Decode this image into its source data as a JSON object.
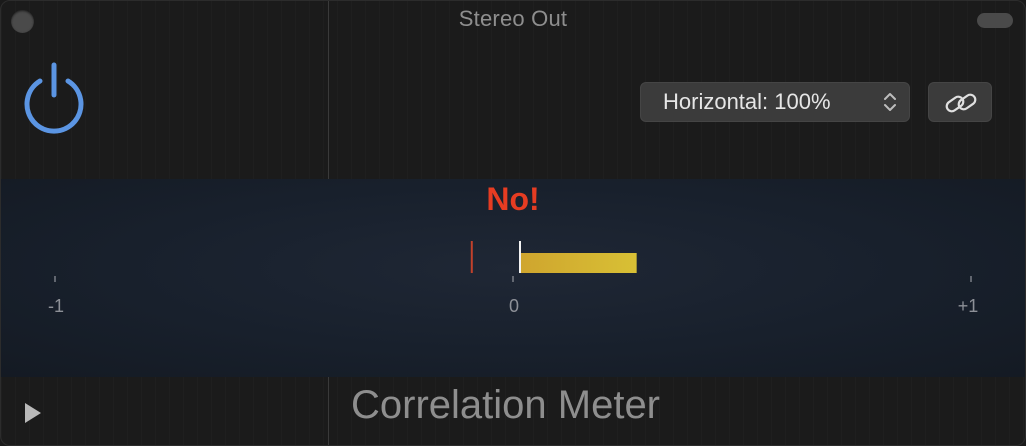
{
  "window": {
    "title": "Stereo Out",
    "footer_title": "Correlation Meter"
  },
  "toolbar": {
    "power_icon": "power-icon",
    "view_select_value": "Horizontal: 100%",
    "link_icon": "link-icon"
  },
  "meter": {
    "warning_text": "No!",
    "scale_labels": [
      "-1",
      "0",
      "+1"
    ],
    "correlation_value": 0.27,
    "peak_hold": -0.09,
    "colors": {
      "warning": "#e63c22",
      "negative": "#c0442a",
      "positive": "#8cc43a",
      "bar": "#d9b531"
    }
  }
}
